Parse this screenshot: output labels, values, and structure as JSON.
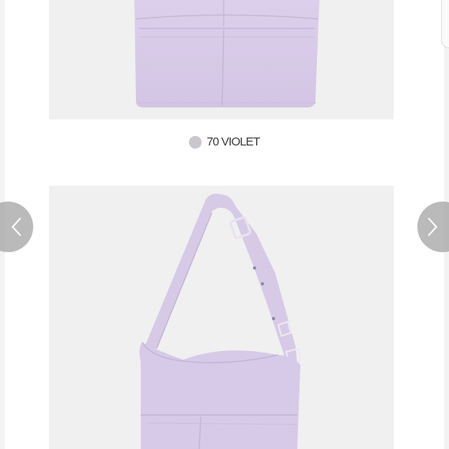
{
  "product_color": {
    "label": "70 VIOLET",
    "swatch_color": "#c9c6cd"
  },
  "images": {
    "top": "lavender-tote-bag-photo",
    "bottom": "lavender-hobo-shoulder-bag-photo"
  },
  "carousel": {
    "prev_icon": "chevron-left-icon",
    "next_icon": "chevron-right-icon"
  },
  "colors": {
    "bag": "#d6c9e6",
    "bag_shadow": "#c2b3d4",
    "photo_bg": "#f0f0f0",
    "nav_button": "#a0a0a0"
  }
}
